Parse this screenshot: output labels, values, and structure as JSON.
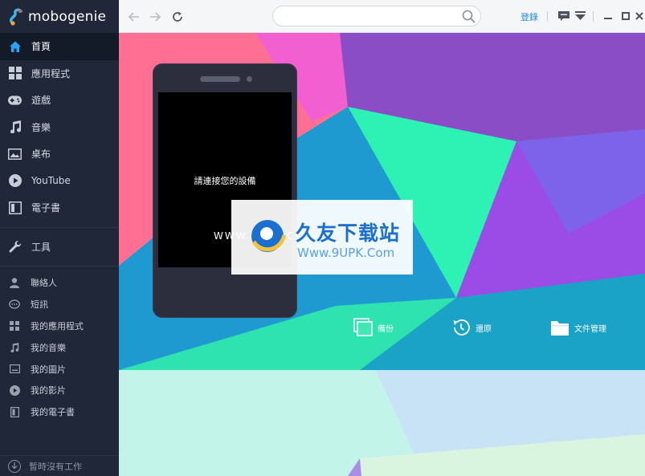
{
  "app": {
    "name": "mobogenie"
  },
  "sidebar": {
    "primary": [
      {
        "label": "首頁",
        "icon": "home-icon",
        "active": true
      },
      {
        "label": "應用程式",
        "icon": "apps-grid-icon"
      },
      {
        "label": "遊戲",
        "icon": "gamepad-icon"
      },
      {
        "label": "音樂",
        "icon": "music-note-icon"
      },
      {
        "label": "桌布",
        "icon": "wallpaper-icon"
      },
      {
        "label": "YouTube",
        "icon": "play-circle-icon"
      },
      {
        "label": "電子書",
        "icon": "book-icon"
      }
    ],
    "tools": {
      "label": "工具",
      "icon": "wrench-icon"
    },
    "device": [
      {
        "label": "聯絡人",
        "icon": "person-icon"
      },
      {
        "label": "短訊",
        "icon": "chat-bubble-icon"
      },
      {
        "label": "我的應用程式",
        "icon": "apps-grid-icon"
      },
      {
        "label": "我的音樂",
        "icon": "music-note-icon"
      },
      {
        "label": "我的圖片",
        "icon": "picture-icon"
      },
      {
        "label": "我的影片",
        "icon": "video-icon"
      },
      {
        "label": "我的電子書",
        "icon": "book-icon"
      }
    ],
    "status": "暫時沒有工作"
  },
  "toolbar": {
    "search_placeholder": "",
    "login": "登錄"
  },
  "main": {
    "phone_message": "請連接您的設備",
    "actions": [
      {
        "label": "備份",
        "icon": "backup-icon"
      },
      {
        "label": "還原",
        "icon": "restore-clock-icon"
      },
      {
        "label": "文件管理",
        "icon": "folder-icon"
      }
    ],
    "watermark": {
      "title": "久友下载站",
      "url": "Www.9UPK.Com",
      "left_text": "WWW.9UPK.COM"
    }
  },
  "colors": {
    "sidebar_bg": "#1f2738",
    "accent": "#1c8ee0"
  }
}
